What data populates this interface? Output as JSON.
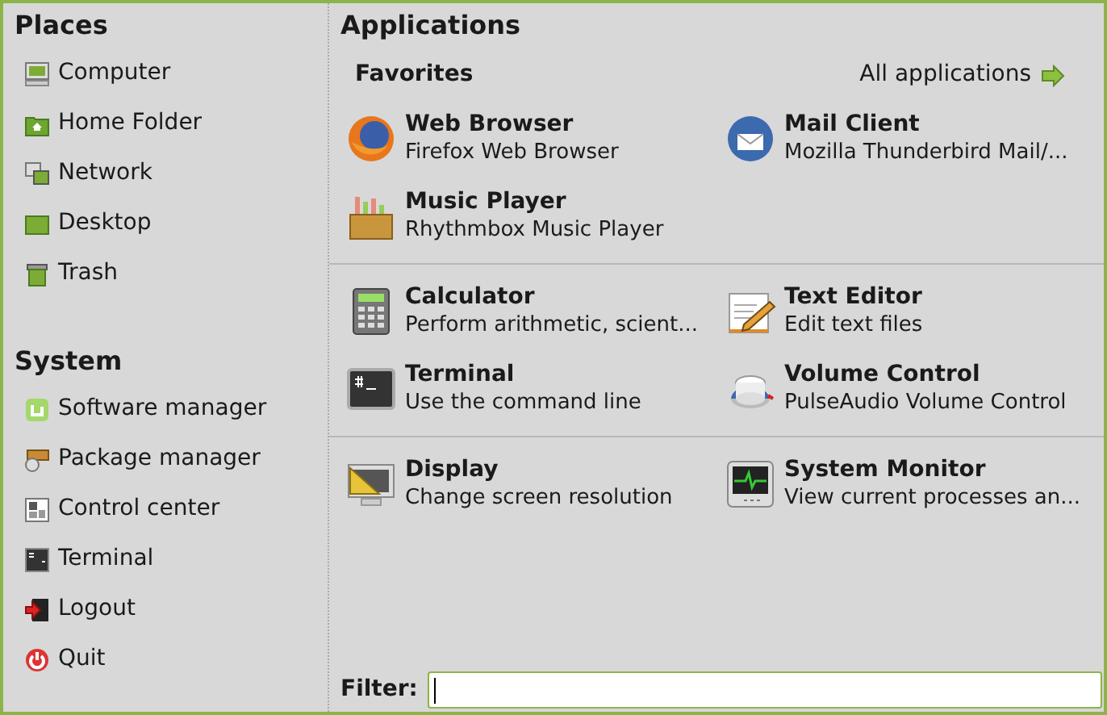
{
  "places": {
    "title": "Places",
    "items": [
      {
        "label": "Computer"
      },
      {
        "label": "Home Folder"
      },
      {
        "label": "Network"
      },
      {
        "label": "Desktop"
      },
      {
        "label": "Trash"
      }
    ]
  },
  "system": {
    "title": "System",
    "items": [
      {
        "label": "Software manager"
      },
      {
        "label": "Package manager"
      },
      {
        "label": "Control center"
      },
      {
        "label": "Terminal"
      },
      {
        "label": "Logout"
      },
      {
        "label": "Quit"
      }
    ]
  },
  "applications": {
    "title": "Applications",
    "favorites_label": "Favorites",
    "all_applications_link": "All applications",
    "groups": [
      [
        {
          "name": "Web Browser",
          "description": "Firefox Web Browser"
        },
        {
          "name": "Mail Client",
          "description": "Mozilla Thunderbird Mail/..."
        },
        {
          "name": "Music Player",
          "description": "Rhythmbox Music Player"
        }
      ],
      [
        {
          "name": "Calculator",
          "description": "Perform arithmetic, scient..."
        },
        {
          "name": "Text Editor",
          "description": "Edit text files"
        },
        {
          "name": "Terminal",
          "description": "Use the command line"
        },
        {
          "name": "Volume Control",
          "description": "PulseAudio Volume Control"
        }
      ],
      [
        {
          "name": "Display",
          "description": "Change screen resolution"
        },
        {
          "name": "System Monitor",
          "description": "View current processes an..."
        }
      ]
    ]
  },
  "filter": {
    "label": "Filter:"
  }
}
